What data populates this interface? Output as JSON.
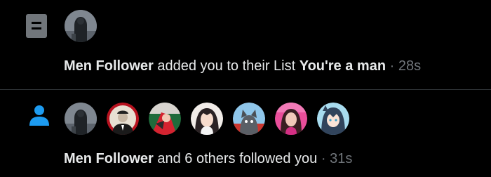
{
  "notifications": [
    {
      "type_icon": "list-icon",
      "actor": "Men Follower",
      "action": "added you to their List",
      "list_name": "You're a man",
      "separator": "·",
      "time": "28s",
      "avatars": [
        "men-follower-avatar"
      ]
    },
    {
      "type_icon": "person-icon",
      "actor": "Men Follower",
      "action": "and 6 others followed you",
      "separator": "·",
      "time": "31s",
      "avatars": [
        "men-follower-avatar",
        "follower-avatar-2",
        "follower-avatar-3",
        "follower-avatar-4",
        "follower-avatar-5",
        "follower-avatar-6",
        "follower-avatar-7"
      ]
    }
  ],
  "colors": {
    "background": "#000000",
    "text": "#e7e9ea",
    "secondary_text": "#71767b",
    "divider": "#2f3336",
    "list_icon": "#71767b",
    "follow_icon": "#1d9bf0"
  }
}
